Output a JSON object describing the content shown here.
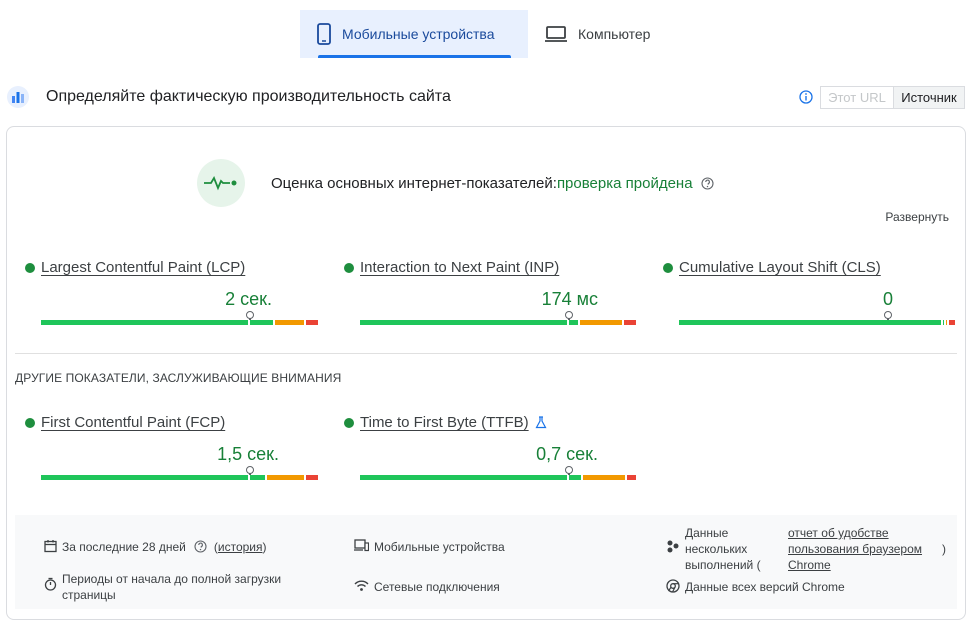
{
  "tabs": [
    {
      "label": "Мобильные устройства",
      "icon": "smartphone-icon",
      "active": true
    },
    {
      "label": "Компьютер",
      "icon": "laptop-icon",
      "active": false
    }
  ],
  "header": {
    "title": "Определяйте фактическую производительность сайта",
    "toggle_url": "Этот URL",
    "toggle_origin": "Источник"
  },
  "assessment": {
    "label": "Оценка основных интернет-показателей:",
    "result": "проверка пройдена",
    "expand": "Развернуть"
  },
  "metrics": [
    {
      "name": "Largest Contentful Paint (LCP)",
      "value": "2 сек.",
      "status": "good",
      "distribution": [
        0.75,
        0.09,
        0.11,
        0.05
      ],
      "marker": 0.75
    },
    {
      "name": "Interaction to Next Paint (INP)",
      "value": "174 мс",
      "status": "good",
      "distribution": [
        0.75,
        0.04,
        0.16,
        0.05
      ],
      "marker": 0.75
    },
    {
      "name": "Cumulative Layout Shift (CLS)",
      "value": "0",
      "status": "good",
      "distribution": [
        0.95,
        0.01,
        0.01,
        0.03
      ],
      "marker": 0.75
    }
  ],
  "other_heading": "ДРУГИЕ ПОКАЗАТЕЛИ, ЗАСЛУЖИВАЮЩИЕ ВНИМАНИЯ",
  "other_metrics": [
    {
      "name": "First Contentful Paint (FCP)",
      "value": "1,5 сек.",
      "status": "good",
      "distribution": [
        0.75,
        0.06,
        0.14,
        0.05
      ],
      "marker": 0.75
    },
    {
      "name": "Time to First Byte (TTFB)",
      "value": "0,7 сек.",
      "status": "good",
      "distribution": [
        0.75,
        0.05,
        0.16,
        0.04
      ],
      "marker": 0.75,
      "experimental_icon": "flask-icon"
    }
  ],
  "footer": {
    "period_label": "За последние 28 дней",
    "period_link": "история",
    "device": "Мобильные устройства",
    "data_sources": "Данные нескольких выполнений (",
    "report_link": "отчет об удобстве пользования браузером Chrome",
    "close_paren": ")",
    "periods": "Периоды от начала до полной загрузки страницы",
    "network": "Сетевые подключения",
    "chrome_versions": "Данные всех версий Chrome"
  },
  "colors": {
    "good": "#1e8e3e",
    "bar_good": "#1fc55a",
    "bar_mid": "#f29900",
    "bar_poor": "#ea4335",
    "accent": "#1a73e8"
  }
}
